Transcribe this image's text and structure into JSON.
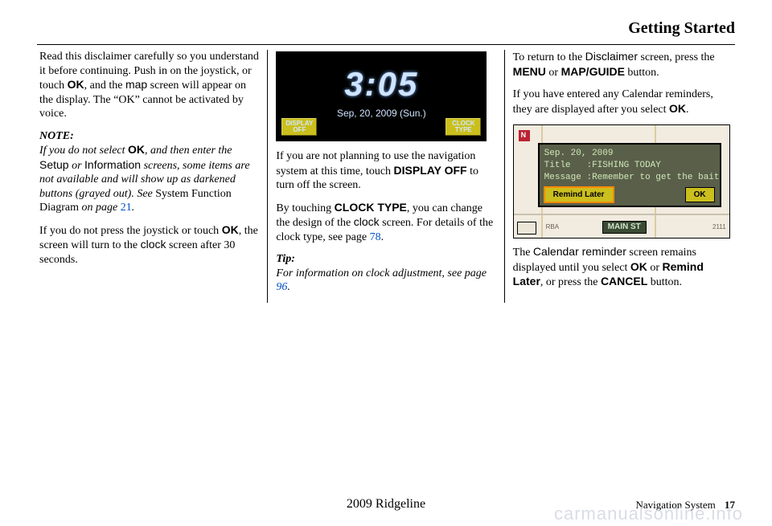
{
  "header": {
    "title": "Getting Started"
  },
  "col1": {
    "p1a": "Read this disclaimer carefully so you understand it before continuing. Push in on the joystick, or touch ",
    "p1b": "OK",
    "p1c": ", and the ",
    "p1d": "map",
    "p1e": " screen will appear on the display. The “OK” cannot be activated by voice.",
    "note_hd": "NOTE:",
    "n1a": "If you do not select ",
    "n1b": "OK",
    "n1c": ", and then enter the ",
    "n1d": "Setup",
    "n1e": " or ",
    "n1f": "Information",
    "n1g": " screens, some items are not available and will show up as darkened buttons (grayed out). See ",
    "n1h": "System Function Diagram",
    "n1i": " on page ",
    "n1j": "21",
    "n1k": ".",
    "p2a": "If you do not press the joystick or touch ",
    "p2b": "OK",
    "p2c": ", the screen will turn to the ",
    "p2d": "clock",
    "p2e": " screen after 30 seconds."
  },
  "clock": {
    "time": "3:05",
    "date": "Sep, 20, 2009 (Sun.)",
    "btn_left_l1": "DISPLAY",
    "btn_left_l2": "OFF",
    "btn_right_l1": "CLOCK",
    "btn_right_l2": "TYPE"
  },
  "col2": {
    "p1a": "If you are not planning to use the navigation system at this time, touch ",
    "p1b": "DISPLAY OFF",
    "p1c": " to turn off the screen.",
    "p2a": "By touching ",
    "p2b": "CLOCK TYPE",
    "p2c": ", you can change the design of the ",
    "p2d": "clock",
    "p2e": " screen. For details of the clock type, see page ",
    "p2f": "78",
    "p2g": ".",
    "tip_hd": "Tip:",
    "tip_a": "For information on clock adjustment, see page ",
    "tip_b": "96",
    "tip_c": "."
  },
  "col3": {
    "p1a": "To return to the ",
    "p1b": "Disclaimer",
    "p1c": " screen, press the ",
    "p1d": "MENU",
    "p1e": " or ",
    "p1f": "MAP/GUIDE",
    "p1g": " button.",
    "p2a": "If you have entered any Calendar reminders, they are displayed after you select ",
    "p2b": "OK",
    "p2c": ".",
    "p3a": "The ",
    "p3b": "Calendar reminder",
    "p3c": " screen remains displayed until you select ",
    "p3d": "OK",
    "p3e": " or ",
    "p3f": "Remind Later",
    "p3g": ", or press the ",
    "p3h": "CANCEL",
    "p3i": " button."
  },
  "reminder": {
    "date": "Sep. 20, 2009",
    "title": "Title   :FISHING TODAY",
    "message": "Message :Remember to get the bait",
    "btn_later": "Remind Later",
    "btn_ok": "OK"
  },
  "map_labels": {
    "mainst": "MAIN ST",
    "st": "ST",
    "rba": "RBA",
    "num": "2111"
  },
  "footer": {
    "model": "2009  Ridgeline",
    "section": "Navigation System",
    "page": "17"
  },
  "watermark": "carmanualsonline.info"
}
